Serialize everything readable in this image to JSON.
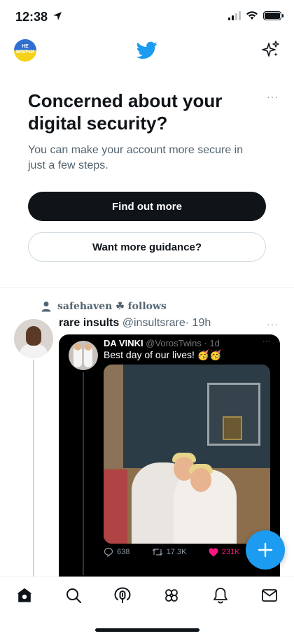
{
  "status_bar": {
    "time": "12:38"
  },
  "header": {
    "avatar_text_line1": "НЕ",
    "avatar_text_line2": "МОЛЧИ"
  },
  "security_card": {
    "title": "Concerned about your digital security?",
    "body": "You can make your account more secure in just a few steps.",
    "primary_button": "Find out more",
    "secondary_button": "Want more guidance?",
    "more_label": "···"
  },
  "tweet": {
    "retweeted_by": "safehaven ☘ follows",
    "author_name": "rare insults",
    "author_handle": "@insultsrare",
    "time": "· 19h",
    "more_label": "···",
    "quoted": {
      "author_name": "DA VINKI",
      "author_handle": "@VorosTwins · 1d",
      "more_label": "···",
      "text": "Best day of our lives! 🥳🥳",
      "replies": "638",
      "retweets": "17.3K",
      "likes": "231K"
    }
  },
  "colors": {
    "accent": "#1d9bf0",
    "text": "#0f1419",
    "secondary_text": "#536471",
    "like": "#f91880"
  },
  "bottom_nav": [
    "home-icon",
    "search-icon",
    "spaces-icon",
    "communities-icon",
    "notifications-icon",
    "messages-icon"
  ]
}
